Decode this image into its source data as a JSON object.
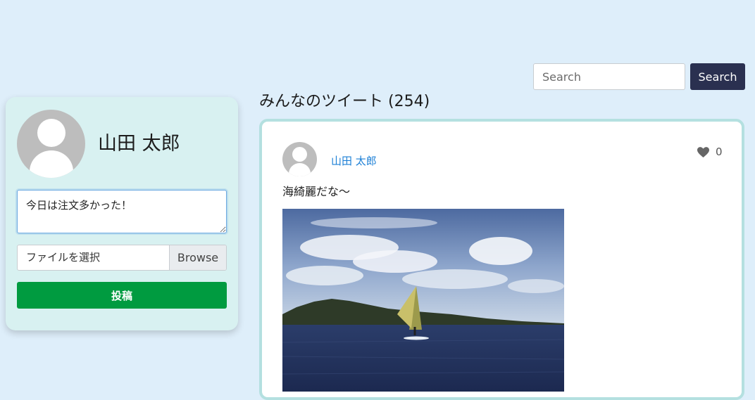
{
  "search": {
    "placeholder": "Search",
    "button_label": "Search"
  },
  "profile": {
    "name": "山田 太郎",
    "tweet_input_value": "今日は注文多かった！",
    "file_label": "ファイルを選択",
    "browse_label": "Browse",
    "post_label": "投稿"
  },
  "feed": {
    "title": "みんなのツイート (254)",
    "tweets": [
      {
        "user": "山田 太郎",
        "likes": "0",
        "text": "海綺麗だな〜",
        "image": "windsurfer-on-sea-photo"
      }
    ]
  },
  "colors": {
    "page_bg": "#deeefa",
    "card_bg": "#d8f1f1",
    "search_button": "#2a3050",
    "post_button": "#009b40",
    "link": "#1b7fd6"
  }
}
